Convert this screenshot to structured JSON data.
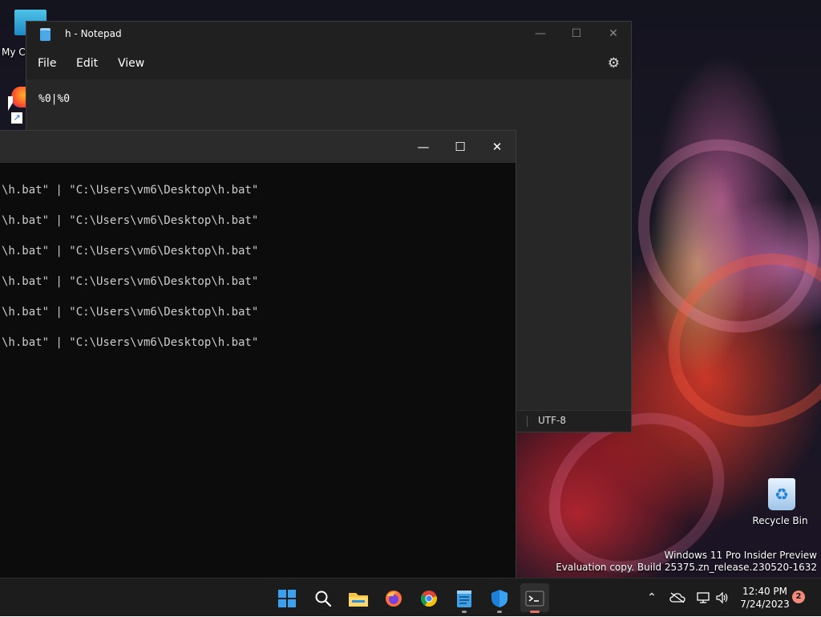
{
  "desktop": {
    "mypc_label": "My C",
    "recycle_label": "Recycle Bin",
    "watermark_line1": "Windows 11 Pro Insider Preview",
    "watermark_line2": "Evaluation copy. Build 25375.zn_release.230520-1632"
  },
  "notepad": {
    "title": "h - Notepad",
    "menu": {
      "file": "File",
      "edit": "Edit",
      "view": "View"
    },
    "content": "%0|%0",
    "encoding": "UTF-8",
    "controls": {
      "minimize": "—",
      "maximize": "☐",
      "close": "✕"
    }
  },
  "terminal": {
    "controls": {
      "minimize": "—",
      "maximize": "☐",
      "close": "✕"
    },
    "lines": [
      "\\h.bat\" | \"C:\\Users\\vm6\\Desktop\\h.bat\"",
      "\\h.bat\" | \"C:\\Users\\vm6\\Desktop\\h.bat\"",
      "\\h.bat\" | \"C:\\Users\\vm6\\Desktop\\h.bat\"",
      "\\h.bat\" | \"C:\\Users\\vm6\\Desktop\\h.bat\"",
      "\\h.bat\" | \"C:\\Users\\vm6\\Desktop\\h.bat\"",
      "\\h.bat\" | \"C:\\Users\\vm6\\Desktop\\h.bat\""
    ]
  },
  "taskbar": {
    "icons": [
      "start-icon",
      "search-icon",
      "file-explorer-icon",
      "firefox-icon",
      "chrome-icon",
      "notepad-icon",
      "defender-icon",
      "terminal-icon"
    ],
    "clock_time": "12:40 PM",
    "clock_date": "7/24/2023",
    "notification_count": "2"
  },
  "colors": {
    "accent": "#3aa0f0",
    "active_indicator": "#e0776b",
    "notif_badge": "#f48a7c"
  }
}
